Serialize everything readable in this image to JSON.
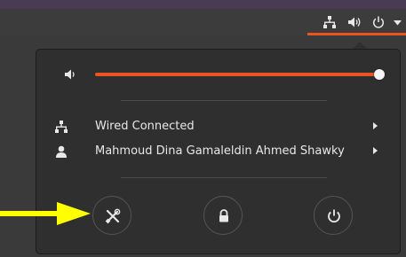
{
  "menu": {
    "wired": {
      "label": "Wired Connected",
      "icon": "network-wired-icon"
    },
    "user": {
      "label": "Mahmoud Dina Gamaleldin Ahmed Shawky",
      "icon": "user-icon"
    },
    "volume": {
      "level": 1.0,
      "icon": "speaker-icon"
    },
    "actions": [
      {
        "name": "settings",
        "icon": "tools-icon"
      },
      {
        "name": "lock",
        "icon": "lock-icon"
      },
      {
        "name": "power",
        "icon": "power-icon"
      }
    ]
  },
  "topbar": {
    "indicators": [
      "network-icon",
      "volume-icon",
      "power-icon",
      "dropdown-arrow-icon"
    ]
  },
  "colors": {
    "accent": "#e95420",
    "menu_bg": "#2f2f2f",
    "pointer": "#ffff00"
  }
}
